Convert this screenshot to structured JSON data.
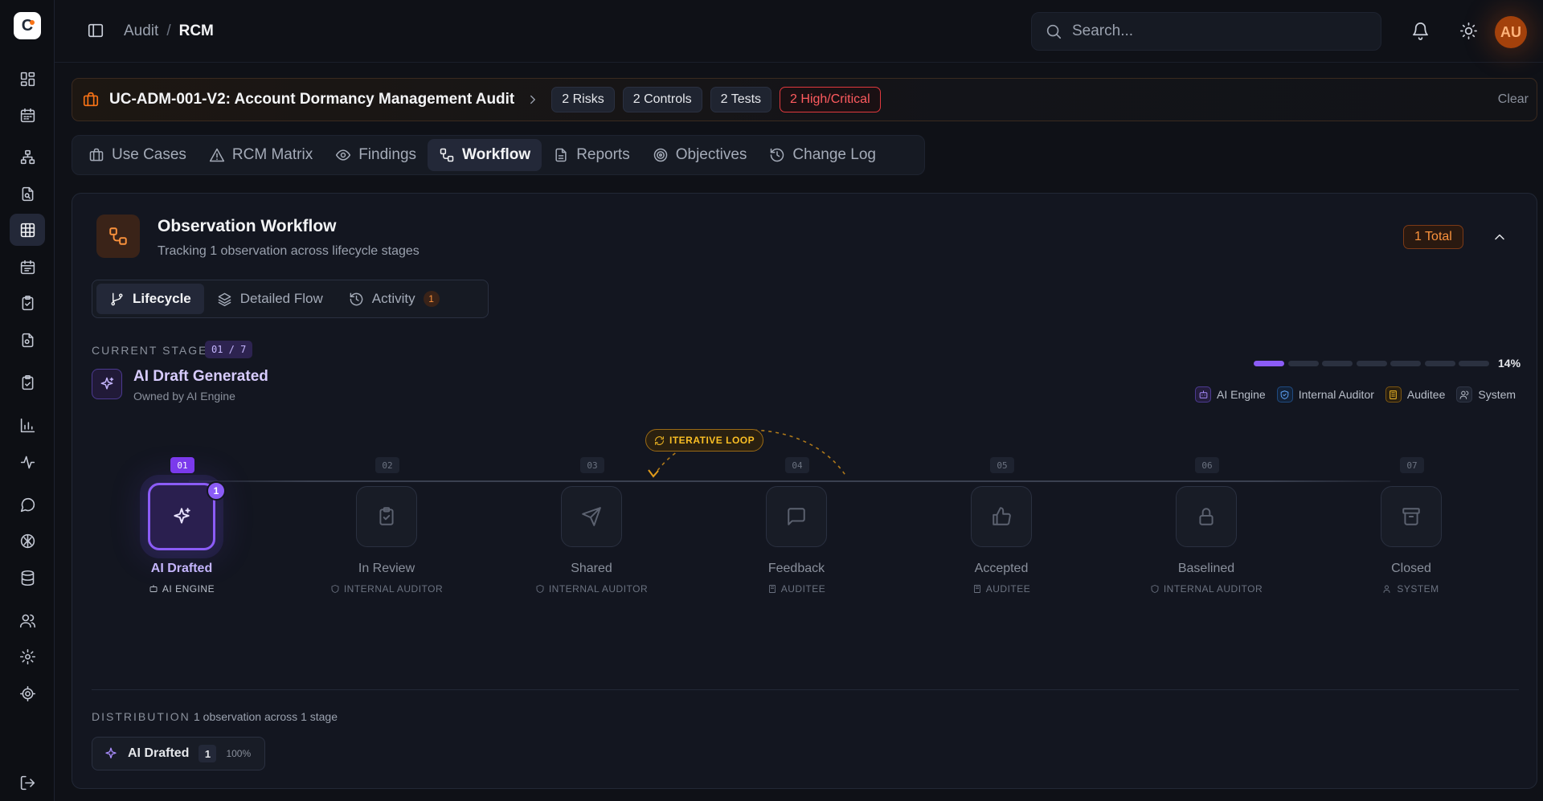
{
  "breadcrumb": {
    "parent": "Audit",
    "separator": "/",
    "current": "RCM"
  },
  "search": {
    "placeholder": "Search..."
  },
  "user": {
    "initials": "AU"
  },
  "banner": {
    "title": "UC-ADM-001-V2: Account Dormancy Management Audit",
    "pills": [
      "2 Risks",
      "2 Controls",
      "2 Tests"
    ],
    "alert_pill": "2 High/Critical",
    "clear": "Clear"
  },
  "tabs": [
    {
      "label": "Use Cases",
      "icon": "briefcase-icon"
    },
    {
      "label": "RCM Matrix",
      "icon": "warning-icon"
    },
    {
      "label": "Findings",
      "icon": "eye-icon"
    },
    {
      "label": "Workflow",
      "icon": "workflow-icon",
      "active": true
    },
    {
      "label": "Reports",
      "icon": "document-icon"
    },
    {
      "label": "Objectives",
      "icon": "target-icon"
    },
    {
      "label": "Change Log",
      "icon": "history-icon"
    }
  ],
  "card": {
    "title": "Observation Workflow",
    "subtitle": "Tracking 1 observation across lifecycle stages",
    "total": "1 Total"
  },
  "subtabs": [
    {
      "label": "Lifecycle",
      "active": true
    },
    {
      "label": "Detailed Flow"
    },
    {
      "label": "Activity",
      "count": "1"
    }
  ],
  "current_stage": {
    "label": "CURRENT STAGE",
    "badge": "01 / 7",
    "title": "AI Draft Generated",
    "owner": "Owned by AI Engine",
    "progress_fraction": 0.14,
    "percent": "14%"
  },
  "legend": [
    {
      "label": "AI Engine",
      "color": "#8b5cf6",
      "icon": "bot-icon"
    },
    {
      "label": "Internal Auditor",
      "color": "#3b82f6",
      "icon": "shield-icon"
    },
    {
      "label": "Auditee",
      "color": "#f59e0b",
      "icon": "building-icon"
    },
    {
      "label": "System",
      "color": "#9aa1ae",
      "icon": "users-icon"
    }
  ],
  "loop_label": "ITERATIVE LOOP",
  "stages": [
    {
      "num": "01",
      "name": "AI Drafted",
      "owner": "AI ENGINE",
      "count": "1",
      "active": true,
      "icon": "sparkle-icon"
    },
    {
      "num": "02",
      "name": "In Review",
      "owner": "INTERNAL AUDITOR",
      "icon": "clipboard-check-icon"
    },
    {
      "num": "03",
      "name": "Shared",
      "owner": "INTERNAL AUDITOR",
      "icon": "send-icon"
    },
    {
      "num": "04",
      "name": "Feedback",
      "owner": "AUDITEE",
      "icon": "message-icon"
    },
    {
      "num": "05",
      "name": "Accepted",
      "owner": "AUDITEE",
      "icon": "thumbs-up-icon"
    },
    {
      "num": "06",
      "name": "Baselined",
      "owner": "INTERNAL AUDITOR",
      "icon": "lock-icon"
    },
    {
      "num": "07",
      "name": "Closed",
      "owner": "SYSTEM",
      "icon": "archive-icon"
    }
  ],
  "distribution": {
    "label": "DISTRIBUTION",
    "summary": "1 observation across 1 stage",
    "chip": {
      "name": "AI Drafted",
      "count": "1",
      "percent": "100%"
    }
  }
}
